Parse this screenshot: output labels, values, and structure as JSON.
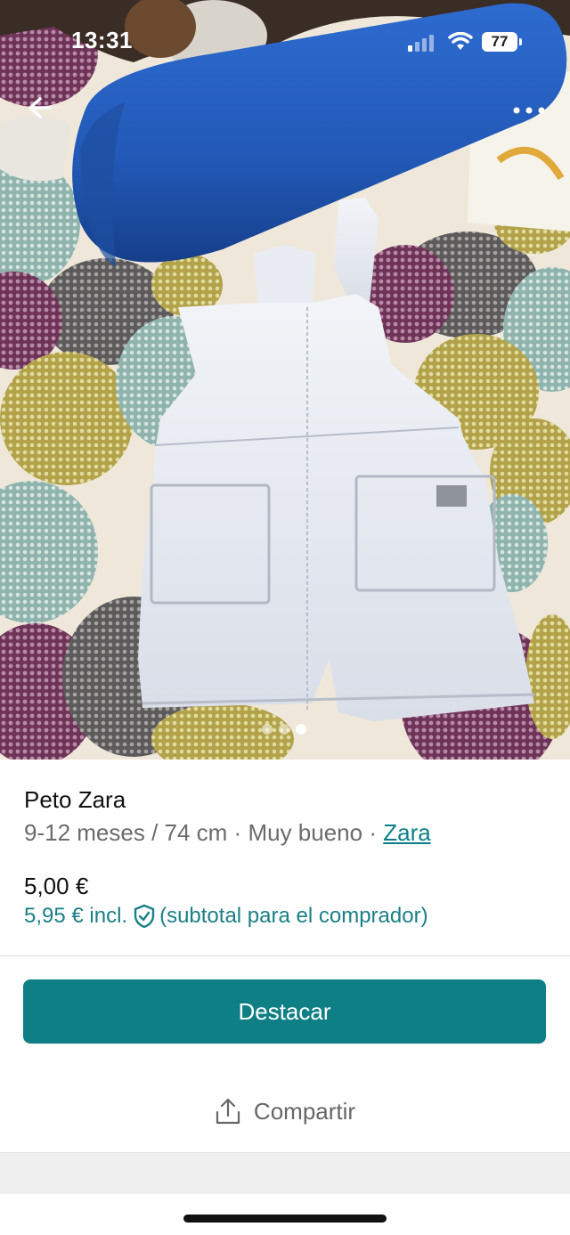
{
  "status_bar": {
    "time": "13:31",
    "battery": "77",
    "icons": [
      "signal-icon",
      "wifi-icon",
      "battery-icon"
    ]
  },
  "nav": {
    "back_icon": "arrow-left-icon",
    "more_icon": "more-dots-icon"
  },
  "gallery": {
    "photo_description_icon": "product-photo",
    "dots_total": 3,
    "active_index": 2
  },
  "item": {
    "title": "Peto Zara",
    "size": "9-12 meses / 74 cm",
    "separator": "·",
    "condition": "Muy bueno",
    "brand": "Zara",
    "price": "5,00 €",
    "price_incl": "5,95 € incl.",
    "price_incl_note": "(subtotal para el comprador)"
  },
  "actions": {
    "feature_label": "Destacar",
    "share_label": "Compartir"
  },
  "colors": {
    "accent": "#0e7f85",
    "link": "#1a7f86",
    "muted_text": "#6b6b6b"
  }
}
